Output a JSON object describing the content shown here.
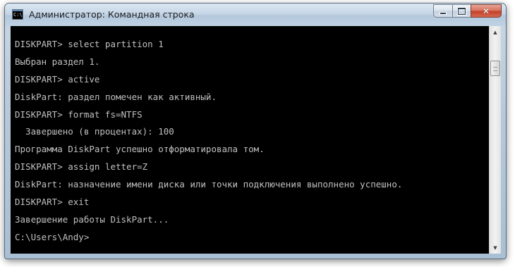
{
  "window": {
    "title": "Администратор: Командная строка",
    "icon": "cmd-icon",
    "icon_text": "C:\\",
    "buttons": {
      "minimize": "minimize-icon",
      "maximize": "maximize-icon",
      "close": "close-icon"
    }
  },
  "console": {
    "lines": [
      "DISKPART> select partition 1",
      "Выбран раздел 1.",
      "DISKPART> active",
      "DiskPart: раздел помечен как активный.",
      "DISKPART> format fs=NTFS",
      "  Завершено (в процентах): 100",
      "Программа DiskPart успешно отформатировала том.",
      "DISKPART> assign letter=Z",
      "DiskPart: назначение имени диска или точки подключения выполнено успешно.",
      "DISKPART> exit",
      "Завершение работы DiskPart...",
      "C:\\Users\\Andy>"
    ],
    "background": "#000000",
    "foreground": "#c0c0c0"
  },
  "scrollbar": {
    "up_arrow": "▲",
    "down_arrow": "▼"
  }
}
